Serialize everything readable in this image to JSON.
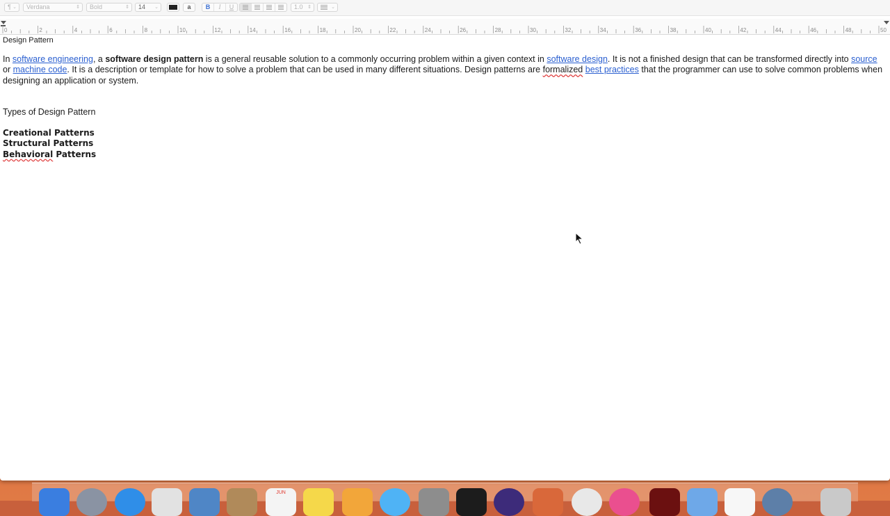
{
  "toolbar": {
    "paragraph_style": "¶",
    "font_family": "Verdana",
    "typeface": "Bold",
    "font_size": "14",
    "bg_color_glyph": "a",
    "bold": "B",
    "italic": "I",
    "underline": "U",
    "line_spacing": "1.0"
  },
  "ruler": {
    "labels": [
      "0",
      "2",
      "4",
      "6",
      "8",
      "10",
      "12",
      "14",
      "16",
      "18",
      "20",
      "22",
      "24",
      "26",
      "28",
      "30",
      "32",
      "34",
      "36",
      "38",
      "40",
      "42",
      "44",
      "46",
      "48",
      "50"
    ]
  },
  "document": {
    "title": "Design Pattern",
    "para": {
      "t1": "In ",
      "link1": "software engineering",
      "t2": ", a ",
      "bold1": "software design pattern",
      "t3": " is a general reusable solution to a commonly occurring problem within a given context in ",
      "link2": "software design",
      "t4": ". It is not a finished design that can be transformed directly into ",
      "link3": "source",
      "t5": " or ",
      "link4": "machine code",
      "t6": ". It is a description or template for how to solve a problem that can be used in many different situations. Design patterns are ",
      "spell1": "formalized",
      "t7": " ",
      "link5": "best practices",
      "t8": " that the programmer can use to solve common problems when designing an application or system."
    },
    "types_heading": "Types of Design Pattern",
    "patterns": [
      "Creational Patterns",
      "Structural Patterns"
    ],
    "pattern3_spell": "Behavioral",
    "pattern3_rest": " Patterns"
  },
  "dock": {
    "icons": [
      "finder-icon",
      "launchpad-icon",
      "safari-icon",
      "mission-control-icon",
      "preview-icon",
      "contacts-icon",
      "calendar-icon",
      "notes-icon",
      "photos-icon",
      "messages-icon",
      "system-preferences-icon",
      "terminal-icon",
      "eclipse-icon",
      "git-icon",
      "chrome-icon",
      "itunes-icon",
      "pdf-icon",
      "finder-folder-icon",
      "textedit-icon",
      "network-icon",
      "trash-icon"
    ],
    "calendar_month": "JUN"
  }
}
